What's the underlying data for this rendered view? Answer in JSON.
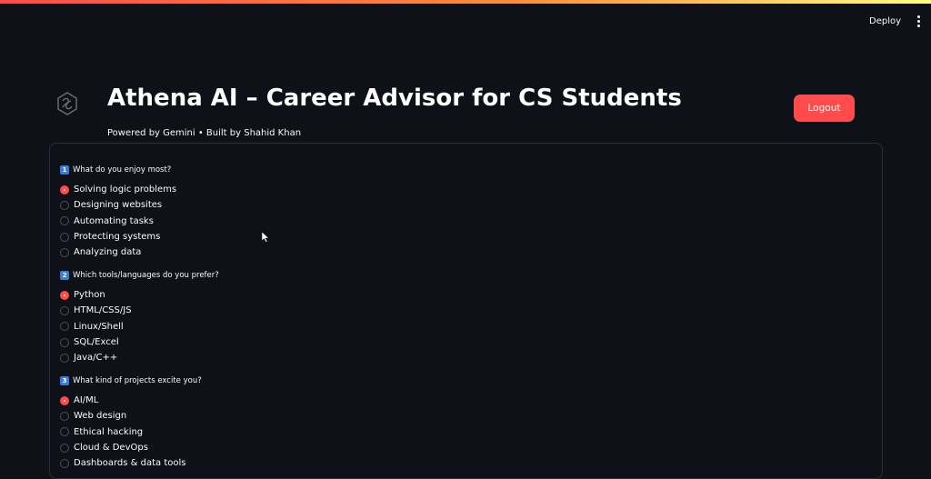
{
  "header": {
    "deploy_label": "Deploy",
    "menu_icon": "more-vert-icon"
  },
  "app": {
    "title": "Athena AI – Career Advisor for CS Students",
    "subtitle": "Powered by Gemini • Built by Shahid Khan",
    "logout_label": "Logout",
    "logo_icon": "gemini-logo-icon"
  },
  "colors": {
    "accent": "#ff4b4b",
    "background": "#0e1117",
    "text": "#fafafa"
  },
  "questions": [
    {
      "number": "1",
      "label": "What do you enjoy most?",
      "options": [
        "Solving logic problems",
        "Designing websites",
        "Automating tasks",
        "Protecting systems",
        "Analyzing data"
      ],
      "selected": 0
    },
    {
      "number": "2",
      "label": "Which tools/languages do you prefer?",
      "options": [
        "Python",
        "HTML/CSS/JS",
        "Linux/Shell",
        "SQL/Excel",
        "Java/C++"
      ],
      "selected": 0
    },
    {
      "number": "3",
      "label": "What kind of projects excite you?",
      "options": [
        "AI/ML",
        "Web design",
        "Ethical hacking",
        "Cloud & DevOps",
        "Dashboards & data tools"
      ],
      "selected": 0
    }
  ]
}
